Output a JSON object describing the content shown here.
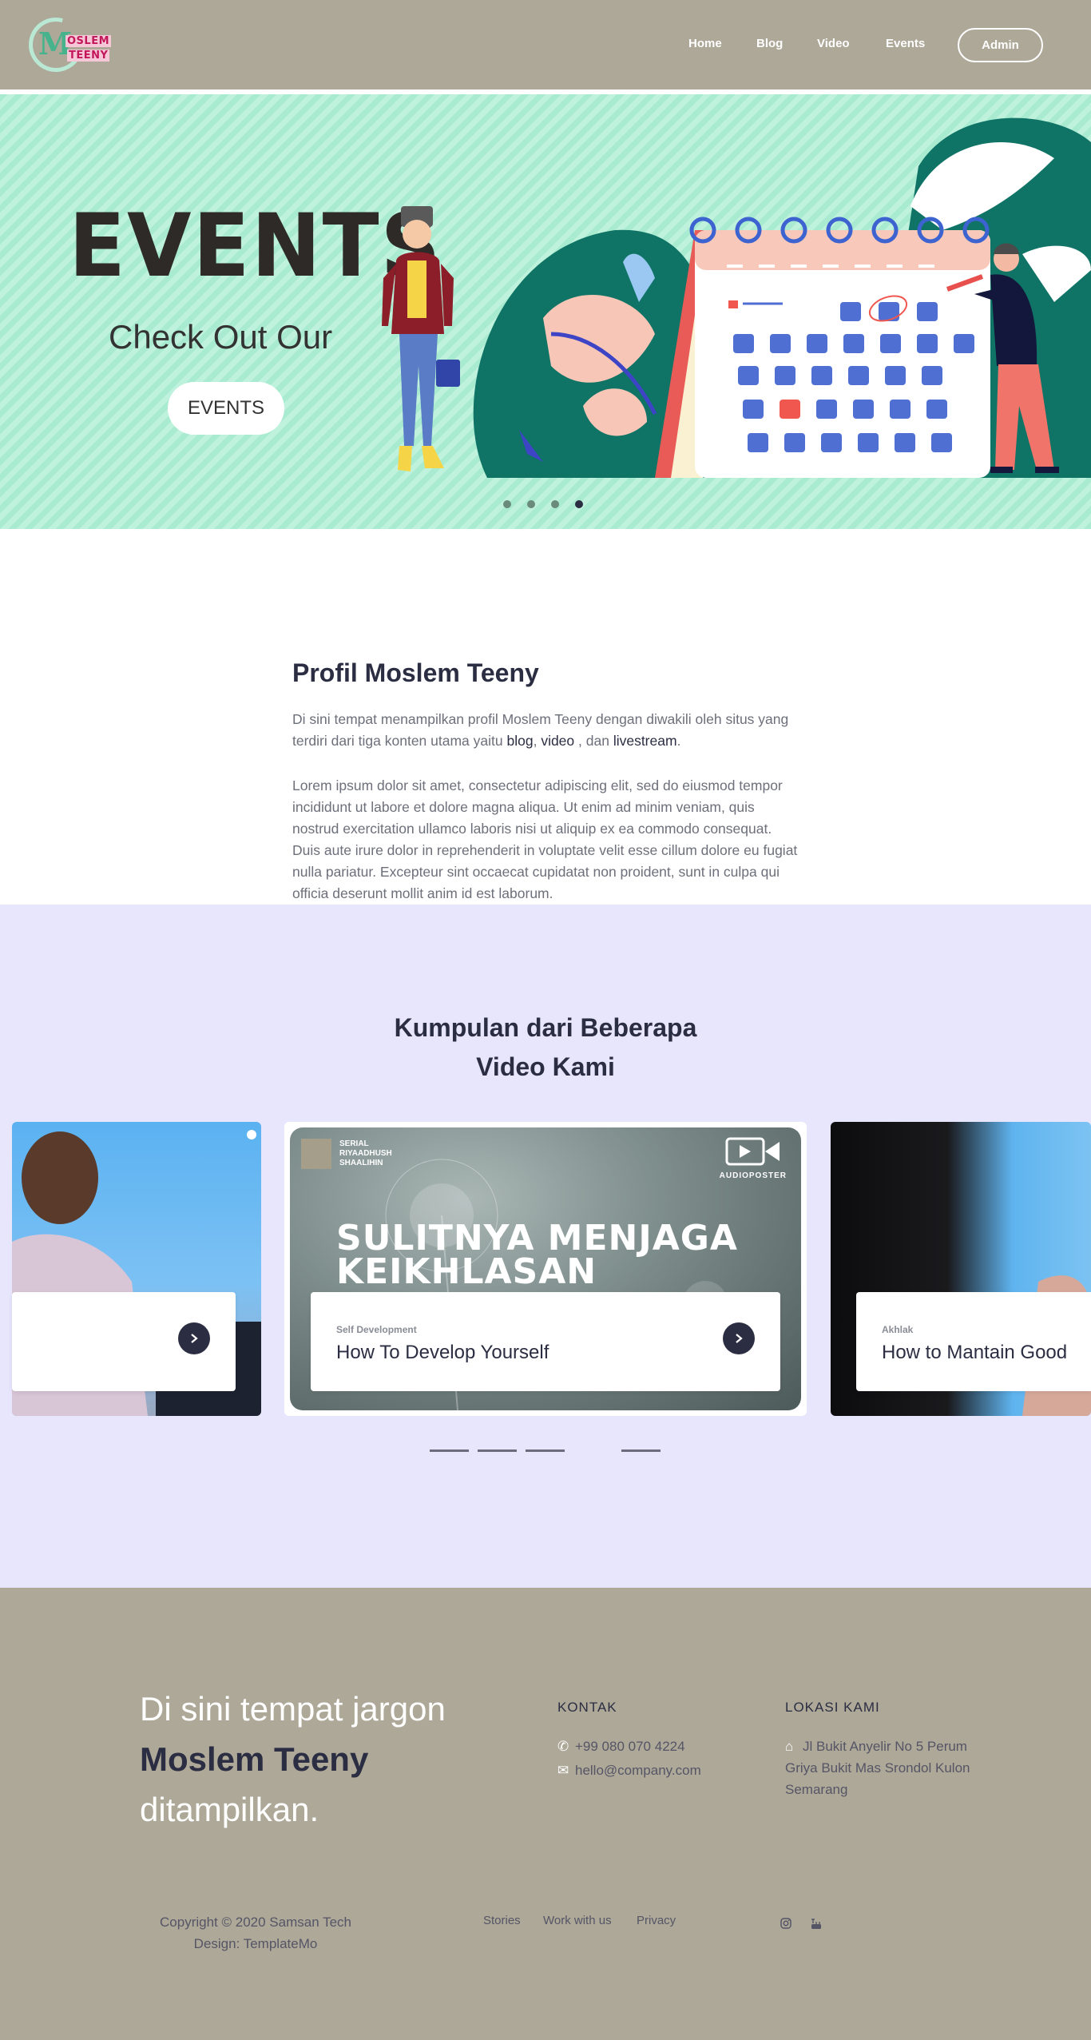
{
  "navbar": {
    "logo": {
      "letter": "M",
      "line1": "OSLEM",
      "line2": "TEENY"
    },
    "links": [
      "Home",
      "Blog",
      "Video",
      "Events"
    ],
    "admin_label": "Admin"
  },
  "hero": {
    "title": "EVENTS",
    "subtitle": "Check Out Our",
    "button_label": "EVENTS",
    "slides": 4,
    "active_slide": 4
  },
  "profile": {
    "title": "Profil Moslem Teeny",
    "intro_prefix": "Di sini tempat menampilkan profil Moslem Teeny dengan diwakili oleh situs yang terdiri dari tiga konten utama yaitu ",
    "intro_blog": "blog",
    "intro_video": "video",
    "intro_and": " , dan ",
    "intro_live": "livestream",
    "intro_suffix": ".",
    "lorem": "Lorem ipsum dolor sit amet, consectetur adipiscing elit, sed do eiusmod tempor incididunt ut labore et dolore magna aliqua. Ut enim ad minim veniam, quis nostrud exercitation ullamco laboris nisi ut aliquip ex ea commodo consequat. Duis aute irure dolor in reprehenderit in voluptate velit esse cillum dolore eu fugiat nulla pariatur. Excepteur sint occaecat cupidatat non proident, sunt in culpa qui officia deserunt mollit anim id est laborum."
  },
  "videos": {
    "title_line1": "Kumpulan dari Beberapa",
    "title_line2": "Video Kami",
    "thumbnail": {
      "series": [
        "SERIAL",
        "RIYAADHUSH",
        "SHAALIHIN"
      ],
      "headline_line1": "SULITNYA MENJAGA",
      "headline_line2": "KEIKHLASAN",
      "brand": "AUDIOPOSTER"
    },
    "cards": [
      {
        "category": "Self Development",
        "title": "How To Develop Yourself"
      },
      {
        "category": "Akhlak",
        "title": "How to Mantain Good"
      }
    ],
    "indicator_count": 4
  },
  "footer": {
    "tag_line1": "Di sini tempat jargon",
    "tag_brand": "Moslem Teeny",
    "tag_line3": "ditampilkan.",
    "contact_heading": "KONTAK",
    "phone": "+99 080 070 4224",
    "email": "hello@company.com",
    "location_heading": "LOKASI KAMI",
    "address": "Jl Bukit Anyelir No 5 Perum Griya Bukit Mas Srondol Kulon Semarang",
    "copyright_line1": "Copyright © 2020 Samsan Tech",
    "copyright_line2": "Design: TemplateMo",
    "links": [
      "Stories",
      "Work with us",
      "Privacy"
    ],
    "social": [
      "instagram-icon",
      "youtube-icon"
    ]
  },
  "colors": {
    "navbar_bg": "#aea898",
    "hero_bg": "#a9ebd0",
    "videos_bg": "#e8e6fd",
    "text_dark": "#2b2d42",
    "footer_bg": "#aea898"
  }
}
